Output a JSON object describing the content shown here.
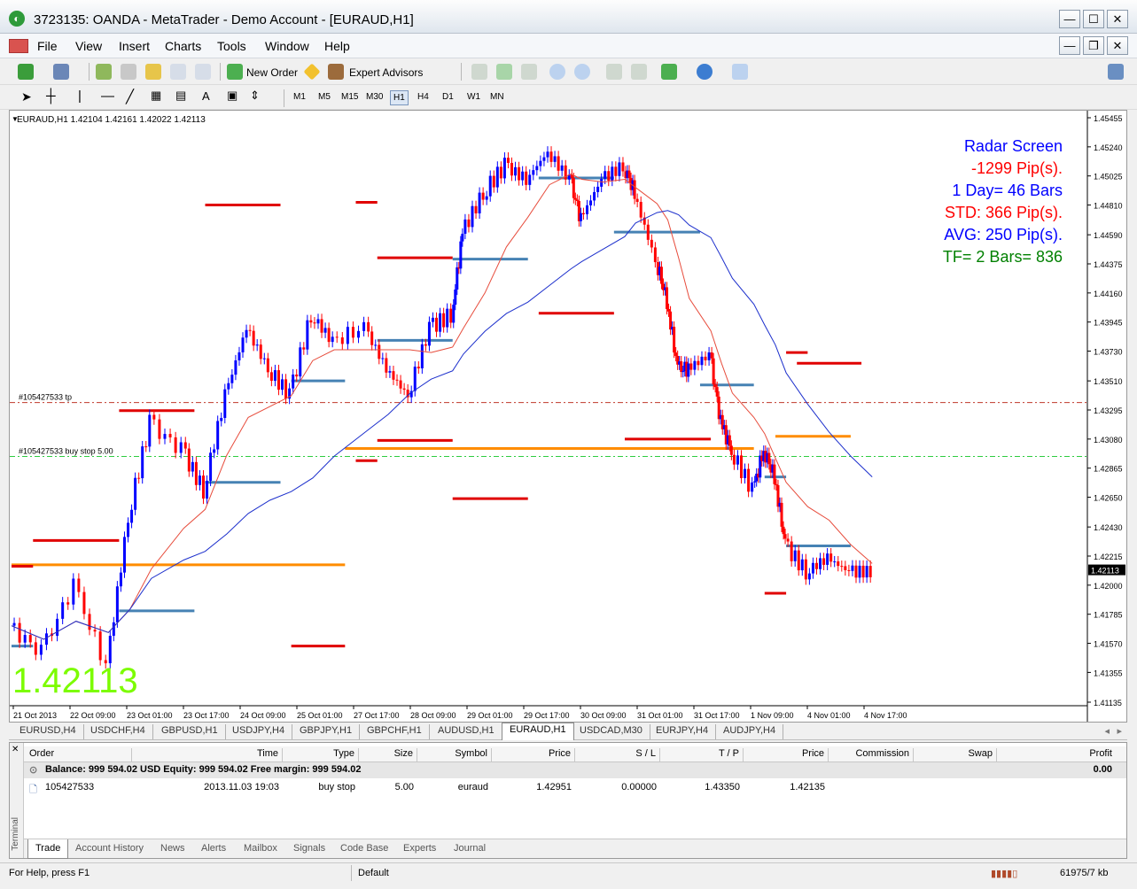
{
  "window": {
    "title": "3723135: OANDA - MetaTrader - Demo Account - [EURAUD,H1]"
  },
  "menu": [
    "File",
    "View",
    "Insert",
    "Charts",
    "Tools",
    "Window",
    "Help"
  ],
  "toolbar": {
    "new_order": "New Order",
    "expert_advisors": "Expert Advisors",
    "timeframes": [
      "M1",
      "M5",
      "M15",
      "M30",
      "H1",
      "H4",
      "D1",
      "W1",
      "MN"
    ],
    "active_timeframe": "H1",
    "text_tool": "A"
  },
  "chart": {
    "header": "EURAUD,H1  1.42104 1.42161 1.42022 1.42113",
    "big_price": "1.42113",
    "radar": [
      {
        "text": "Radar Screen",
        "color": "#0000ff"
      },
      {
        "text": "-1299 Pip(s).",
        "color": "#ff0000"
      },
      {
        "text": "1 Day= 46 Bars",
        "color": "#0000ff"
      },
      {
        "text": "STD: 366 Pip(s).",
        "color": "#ff0000"
      },
      {
        "text": "AVG: 250 Pip(s).",
        "color": "#0000ff"
      },
      {
        "text": "TF= 2 Bars= 836",
        "color": "#008000"
      }
    ],
    "tp_label": "#105427533 tp",
    "buystop_label": "#105427533 buy stop 5.00",
    "current_price_tag": "1.42113"
  },
  "chart_data": {
    "type": "candlestick",
    "symbol": "EURAUD",
    "timeframe": "H1",
    "y_ticks": [
      "1.45455",
      "1.45240",
      "1.45025",
      "1.44810",
      "1.44590",
      "1.44375",
      "1.44160",
      "1.43945",
      "1.43730",
      "1.43510",
      "1.43295",
      "1.43080",
      "1.42865",
      "1.42650",
      "1.42430",
      "1.42215",
      "1.42000",
      "1.41785",
      "1.41570",
      "1.41355",
      "1.41135"
    ],
    "x_ticks": [
      "21 Oct 2013",
      "22 Oct 09:00",
      "23 Oct 01:00",
      "23 Oct 17:00",
      "24 Oct 09:00",
      "25 Oct 01:00",
      "27 Oct 17:00",
      "28 Oct 09:00",
      "29 Oct 01:00",
      "29 Oct 17:00",
      "30 Oct 09:00",
      "31 Oct 01:00",
      "31 Oct 17:00",
      "1 Nov 09:00",
      "4 Nov 01:00",
      "4 Nov 17:00"
    ],
    "ylim": [
      1.41135,
      1.45455
    ],
    "tp_price": 1.4335,
    "buy_stop_price": 1.42951,
    "last_price": 1.42113,
    "close_path": [
      [
        0,
        1.417
      ],
      [
        0.03,
        1.415
      ],
      [
        0.06,
        1.42
      ],
      [
        0.09,
        1.414
      ],
      [
        0.11,
        1.425
      ],
      [
        0.13,
        1.432
      ],
      [
        0.16,
        1.43
      ],
      [
        0.18,
        1.427
      ],
      [
        0.2,
        1.434
      ],
      [
        0.22,
        1.439
      ],
      [
        0.24,
        1.436
      ],
      [
        0.26,
        1.434
      ],
      [
        0.28,
        1.44
      ],
      [
        0.3,
        1.438
      ],
      [
        0.33,
        1.439
      ],
      [
        0.35,
        1.436
      ],
      [
        0.37,
        1.434
      ],
      [
        0.39,
        1.439
      ],
      [
        0.41,
        1.44
      ],
      [
        0.42,
        1.446
      ],
      [
        0.44,
        1.449
      ],
      [
        0.46,
        1.451
      ],
      [
        0.48,
        1.45
      ],
      [
        0.5,
        1.452
      ],
      [
        0.52,
        1.45
      ],
      [
        0.53,
        1.447
      ],
      [
        0.55,
        1.45
      ],
      [
        0.57,
        1.451
      ],
      [
        0.58,
        1.449
      ],
      [
        0.6,
        1.444
      ],
      [
        0.61,
        1.441
      ],
      [
        0.62,
        1.436
      ],
      [
        0.63,
        1.436
      ],
      [
        0.65,
        1.437
      ],
      [
        0.66,
        1.432
      ],
      [
        0.67,
        1.43
      ],
      [
        0.69,
        1.427
      ],
      [
        0.7,
        1.43
      ],
      [
        0.71,
        1.428
      ],
      [
        0.72,
        1.423
      ],
      [
        0.74,
        1.421
      ],
      [
        0.76,
        1.422
      ],
      [
        0.78,
        1.421
      ],
      [
        0.8,
        1.421
      ]
    ],
    "red_levels": [
      [
        0.18,
        0.25,
        1.4481
      ],
      [
        0.32,
        0.34,
        1.4483
      ],
      [
        0.34,
        0.41,
        1.4442
      ],
      [
        0.49,
        0.56,
        1.4401
      ],
      [
        0.57,
        0.65,
        1.4308
      ],
      [
        0.72,
        0.74,
        1.4372
      ],
      [
        0.73,
        0.79,
        1.4364
      ],
      [
        0.02,
        0.1,
        1.4233
      ],
      [
        0.1,
        0.17,
        1.4329
      ],
      [
        0.34,
        0.41,
        1.4307
      ],
      [
        0.41,
        0.48,
        1.4264
      ],
      [
        0.26,
        0.31,
        1.4155
      ],
      [
        0.7,
        0.72,
        1.4194
      ],
      [
        0.0,
        0.02,
        1.4214
      ],
      [
        0.32,
        0.34,
        1.4292
      ]
    ],
    "blue_levels": [
      [
        0.41,
        0.48,
        1.4441
      ],
      [
        0.49,
        0.56,
        1.4501
      ],
      [
        0.56,
        0.64,
        1.4461
      ],
      [
        0.34,
        0.41,
        1.4381
      ],
      [
        0.26,
        0.31,
        1.4351
      ],
      [
        0.18,
        0.25,
        1.4276
      ],
      [
        0.64,
        0.69,
        1.4348
      ],
      [
        0.7,
        0.72,
        1.428
      ],
      [
        0.1,
        0.17,
        1.4181
      ],
      [
        0.72,
        0.78,
        1.4229
      ],
      [
        0.0,
        0.02,
        1.4155
      ]
    ],
    "orange_levels": [
      [
        0.0,
        0.31,
        1.4215
      ],
      [
        0.31,
        0.69,
        1.4301
      ],
      [
        0.71,
        0.78,
        1.431
      ]
    ]
  },
  "symbol_tabs": [
    "EURUSD,H4",
    "USDCHF,H4",
    "GBPUSD,H1",
    "USDJPY,H4",
    "GBPJPY,H1",
    "GBPCHF,H1",
    "AUDUSD,H1",
    "EURAUD,H1",
    "USDCAD,M30",
    "EURJPY,H4",
    "AUDJPY,H4"
  ],
  "active_symbol_tab": "EURAUD,H1",
  "terminal": {
    "side_label": "Terminal",
    "columns": [
      "Order",
      "Time",
      "Type",
      "Size",
      "Symbol",
      "Price",
      "S / L",
      "T / P",
      "Price",
      "Commission",
      "Swap",
      "Profit"
    ],
    "balance_text": "Balance: 999 594.02 USD  Equity: 999 594.02  Free margin: 999 594.02",
    "balance_profit": "0.00",
    "order": {
      "id": "105427533",
      "time": "2013.11.03 19:03",
      "type": "buy stop",
      "size": "5.00",
      "symbol": "euraud",
      "price": "1.42951",
      "sl": "0.00000",
      "tp": "1.43350",
      "current_price": "1.42135"
    },
    "tabs": [
      "Trade",
      "Account History",
      "News",
      "Alerts",
      "Mailbox",
      "Signals",
      "Code Base",
      "Experts",
      "Journal"
    ],
    "active_tab": "Trade"
  },
  "status": {
    "help": "For Help, press F1",
    "profile": "Default",
    "traffic": "61975/7 kb"
  }
}
